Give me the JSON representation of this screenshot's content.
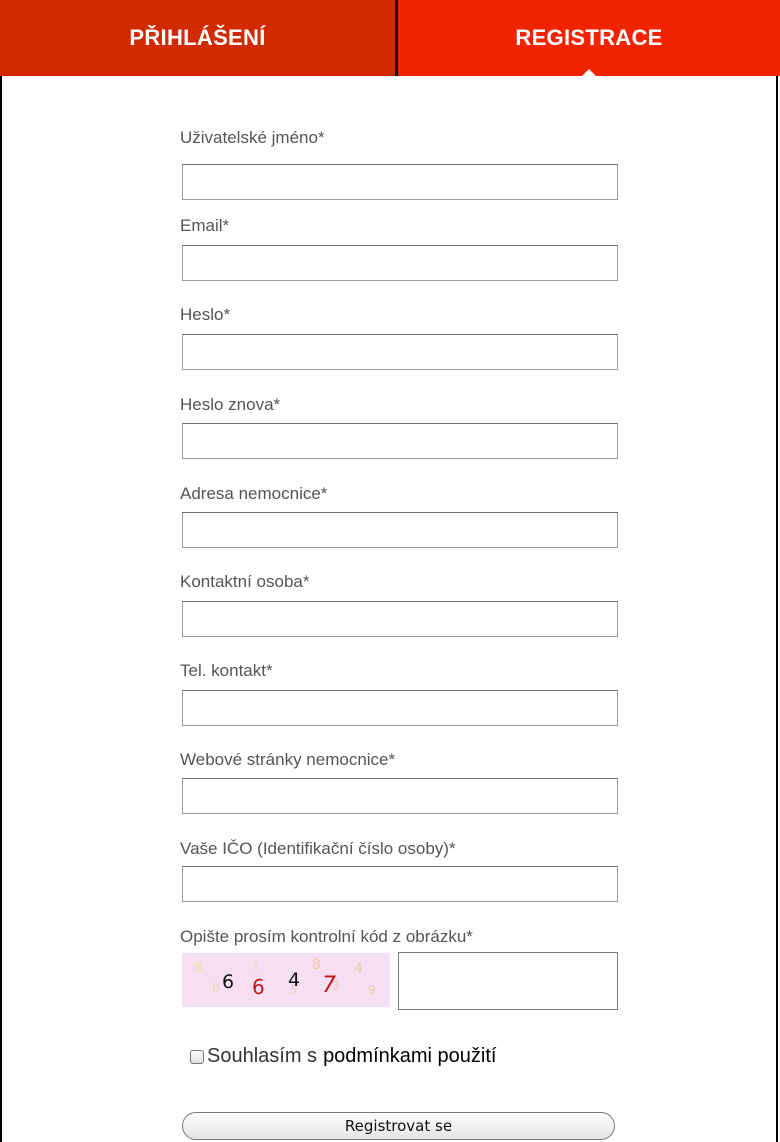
{
  "tabs": {
    "login": "PŘIHLÁŠENÍ",
    "register": "REGISTRACE"
  },
  "form": {
    "fields": [
      {
        "label": "Uživatelské jméno*",
        "value": ""
      },
      {
        "label": "Email*",
        "value": ""
      },
      {
        "label": "Heslo*",
        "value": ""
      },
      {
        "label": "Heslo znova*",
        "value": ""
      },
      {
        "label": "Adresa nemocnice*",
        "value": ""
      },
      {
        "label": "Kontaktní osoba*",
        "value": ""
      },
      {
        "label": "Tel. kontakt*",
        "value": ""
      },
      {
        "label": "Webové stránky nemocnice*",
        "value": ""
      },
      {
        "label": "Vaše IČO (Identifikační číslo osoby)*",
        "value": ""
      }
    ],
    "captcha": {
      "label": "Opište prosím kontrolní kód z obrázku*",
      "digits": [
        "6",
        "6",
        "4",
        "7"
      ]
    },
    "agree": {
      "text": "Souhlasím s",
      "link": "podmínkami použití"
    },
    "submit": "Registrovat se"
  },
  "colors": {
    "tab_login": "#d22a00",
    "tab_register": "#f22400",
    "captcha_bg": "#f6dff2"
  }
}
